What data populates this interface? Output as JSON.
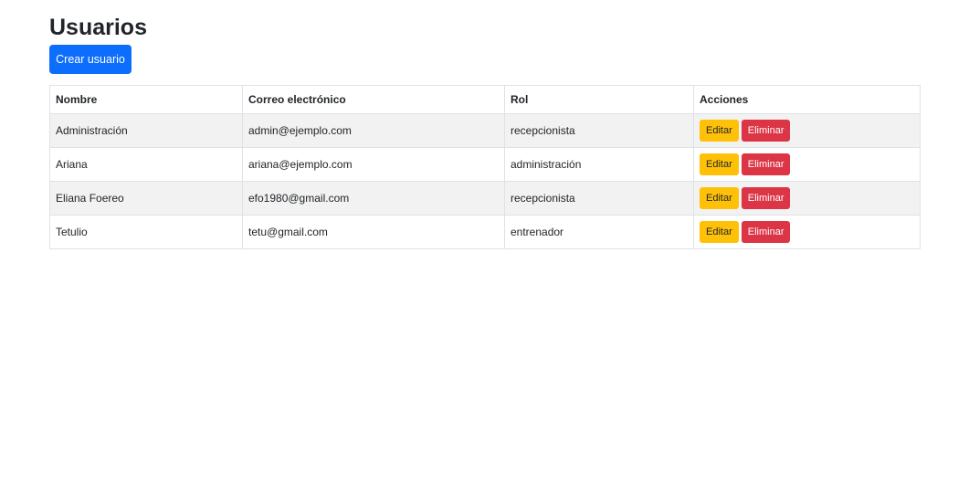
{
  "page": {
    "title": "Usuarios",
    "create_button": "Crear usuario"
  },
  "table": {
    "headers": [
      "Nombre",
      "Correo electrónico",
      "Rol",
      "Acciones"
    ],
    "rows": [
      {
        "name": "Administración",
        "email": "admin@ejemplo.com",
        "rol": "recepcionista"
      },
      {
        "name": "Ariana",
        "email": "ariana@ejemplo.com",
        "rol": "administración"
      },
      {
        "name": "Eliana Foereo",
        "email": "efo1980@gmail.com",
        "rol": "recepcionista"
      },
      {
        "name": "Tetulio",
        "email": "tetu@gmail.com",
        "rol": "entrenador"
      }
    ],
    "edit_label": "Editar",
    "delete_label": "Eliminar"
  },
  "colors": {
    "primary": "#0d6efd",
    "warning": "#ffc107",
    "danger": "#dc3545",
    "striped_row": "#f2f2f2"
  }
}
